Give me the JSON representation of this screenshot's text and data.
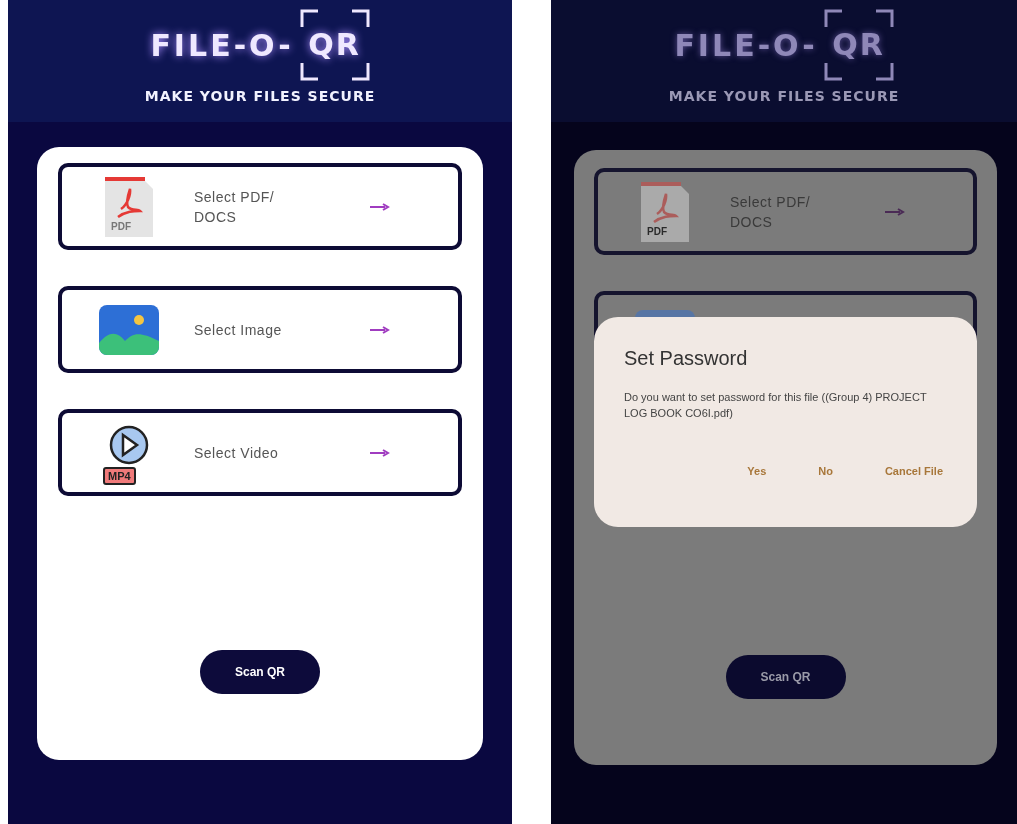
{
  "screens": [
    {
      "dimmed": false,
      "header": {
        "title": "FILE-O-",
        "title_framed": "QR",
        "subtitle": "MAKE YOUR FILES SECURE"
      },
      "options": [
        {
          "kind": "pdf",
          "label": "Select PDF/ DOCS",
          "icon_label": "PDF"
        },
        {
          "kind": "image",
          "label": "Select Image"
        },
        {
          "kind": "video",
          "label": "Select Video",
          "icon_label": "MP4"
        }
      ],
      "scan_button": "Scan QR"
    },
    {
      "dimmed": true,
      "header": {
        "title": "FILE-O-",
        "title_framed": "QR",
        "subtitle": "MAKE YOUR FILES SECURE"
      },
      "options": [
        {
          "kind": "pdf",
          "label": "Select PDF/ DOCS",
          "icon_label": "PDF"
        },
        {
          "kind": "image"
        }
      ],
      "scan_button": "Scan QR",
      "dialog": {
        "title": "Set Password",
        "message": "Do you want to set password for this file ((Group 4) PROJECT LOG BOOK CO6I.pdf)",
        "buttons": [
          "Yes",
          "No",
          "Cancel File"
        ]
      }
    }
  ]
}
